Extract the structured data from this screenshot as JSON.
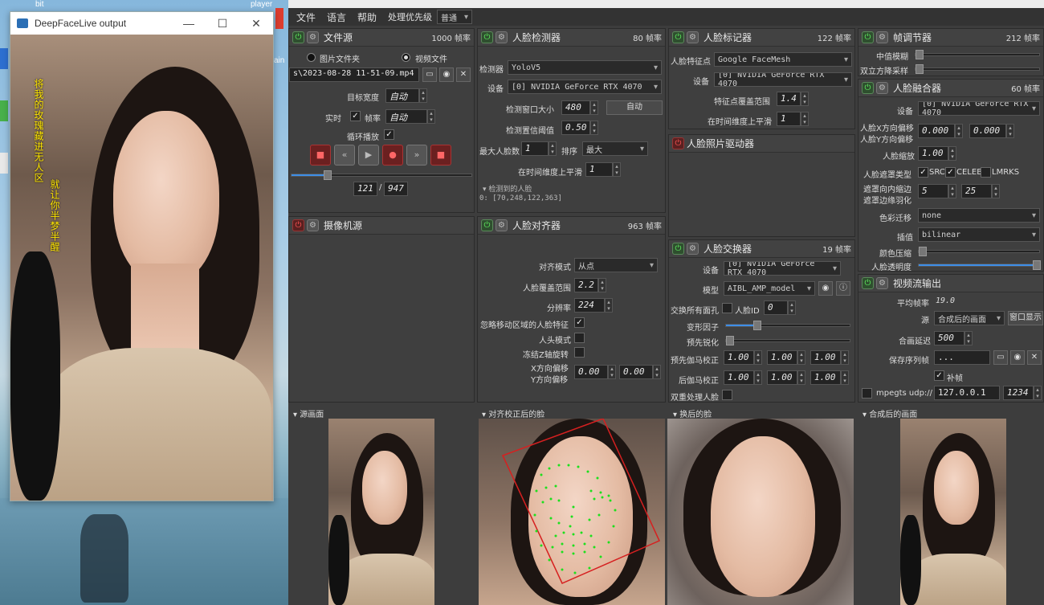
{
  "desktop": {
    "labels": [
      "bit",
      "player",
      "ain"
    ],
    "output_window": {
      "title": "DeepFaceLive output",
      "btn_min": "—",
      "btn_max": "☐",
      "btn_close": "✕",
      "overlay_text_1": "将我的玫瑰藏进无人区",
      "overlay_text_2": "就让你半梦半醒"
    }
  },
  "menu": {
    "file": "文件",
    "language": "语言",
    "help": "帮助",
    "priority_label": "处理优先级",
    "priority_value": "普通"
  },
  "file_source": {
    "title": "文件源",
    "fps": "1000 帧率",
    "opt_image_folder": "图片文件夹",
    "opt_video_file": "视频文件",
    "path": "s\\2023-08-28 11-51-09.mp4",
    "target_width_label": "目标宽度",
    "target_width_value": "自动",
    "realtime_label": "实时",
    "fps_label": "帧率",
    "fps_value": "自动",
    "loop_label": "循环播放",
    "frame_current": "121",
    "frame_total": "947"
  },
  "camera_source": {
    "title": "摄像机源"
  },
  "face_detector": {
    "title": "人脸检测器",
    "fps": "80 帧率",
    "detector_label": "检测器",
    "detector_value": "YoloV5",
    "device_label": "设备",
    "device_value": "[0] NVIDIA GeForce RTX 4070",
    "window_label": "检测窗口大小",
    "window_value": "480",
    "auto_button": "自动",
    "threshold_label": "检测置信阈值",
    "threshold_value": "0.50",
    "max_faces_label": "最大人脸数",
    "max_faces_value": "1",
    "sort_label": "排序",
    "sort_value": "最大",
    "temporal_label": "在时间维度上平滑",
    "temporal_value": "1",
    "detected_header": "检测到的人脸",
    "detected_value": "0: [70,248,122,363]"
  },
  "face_aligner": {
    "title": "人脸对齐器",
    "fps": "963 帧率",
    "mode_label": "对齐模式",
    "mode_value": "从点",
    "coverage_label": "人脸覆盖范围",
    "coverage_value": "2.2",
    "resolution_label": "分辨率",
    "resolution_value": "224",
    "exclude_moving_label": "忽略移动区域的人脸特征",
    "head_mode_label": "人头模式",
    "freeze_z_label": "冻结Z轴旋转",
    "offset_x_label": "X方向偏移",
    "offset_y_label": "Y方向偏移",
    "offset_x_value": "0.00",
    "offset_y_value": "0.00"
  },
  "face_marker": {
    "title": "人脸标记器",
    "fps": "122 帧率",
    "marker_label": "人脸特征点",
    "marker_value": "Google FaceMesh",
    "device_label": "设备",
    "device_value": "[0] NVIDIA GeForce RTX 4070",
    "range_label": "特征点覆盖范围",
    "range_value": "1.4",
    "temporal_label": "在时间维度上平滑",
    "temporal_value": "1"
  },
  "face_animator": {
    "title": "人脸照片驱动器"
  },
  "face_swapper": {
    "title": "人脸交换器",
    "fps": "19 帧率",
    "device_label": "设备",
    "device_value": "[0] NVIDIA GeForce RTX 4070",
    "model_label": "模型",
    "model_value": "AIBL_AMP_model",
    "swap_all_label": "交换所有面孔",
    "face_id_label": "人脸ID",
    "face_id_value": "0",
    "morph_label": "变形因子",
    "presharpen_label": "预先锐化",
    "pre_gamma_label": "预先伽马校正",
    "post_gamma_label": "后伽马校正",
    "gamma_values": [
      "1.00",
      "1.00",
      "1.00"
    ],
    "post_gamma_values": [
      "1.00",
      "1.00",
      "1.00"
    ],
    "two_pass_label": "双重处理人脸"
  },
  "frame_adjuster": {
    "title": "帧调节器",
    "fps": "212 帧率",
    "median_blur_label": "中值模糊",
    "degrade_label": "双立方降采样"
  },
  "face_merger": {
    "title": "人脸融合器",
    "fps": "60 帧率",
    "device_label": "设备",
    "device_value": "[0] NVIDIA GeForce RTX 4070",
    "offset_x_label": "人脸X方向偏移",
    "offset_y_label": "人脸Y方向偏移",
    "offset_x_value": "0.000",
    "offset_y_value": "0.000",
    "scale_label": "人脸缩放",
    "scale_value": "1.00",
    "mask_type_label": "人脸遮罩类型",
    "mask_src": "SRC",
    "mask_celeb": "CELEB",
    "mask_lmrks": "LMRKS",
    "erode_label": "遮罩向内缩边",
    "blur_label": "遮罩边缘羽化",
    "erode_value": "5",
    "blur_value": "25",
    "color_transfer_label": "色彩迁移",
    "color_transfer_value": "none",
    "interp_label": "插值",
    "interp_value": "bilinear",
    "color_compress_label": "颜色压缩",
    "opacity_label": "人脸透明度"
  },
  "stream_output": {
    "title": "视频流输出",
    "avg_fps_label": "平均帧率",
    "avg_fps_value": "19.0",
    "source_label": "源",
    "source_value": "合成后的画面",
    "window_button": "窗口显示",
    "delay_label": "合画延迟",
    "delay_value": "500",
    "save_seq_label": "保存序列帧",
    "save_seq_value": "...",
    "fill_label": "补帧",
    "mpegts_label": "mpegts udp://",
    "mpegts_host": "127.0.0.1",
    "mpegts_port": "1234"
  },
  "previews": {
    "source_frame": "源画面",
    "aligned_face": "对齐校正后的脸",
    "swapped_face": "换后的脸",
    "merged_frame": "合成后的画面"
  },
  "colors": {
    "accent": "#3d8ee8",
    "power_on": "#5ff05f",
    "power_off": "#f55555",
    "panel_bg": "#3f3f3f"
  }
}
